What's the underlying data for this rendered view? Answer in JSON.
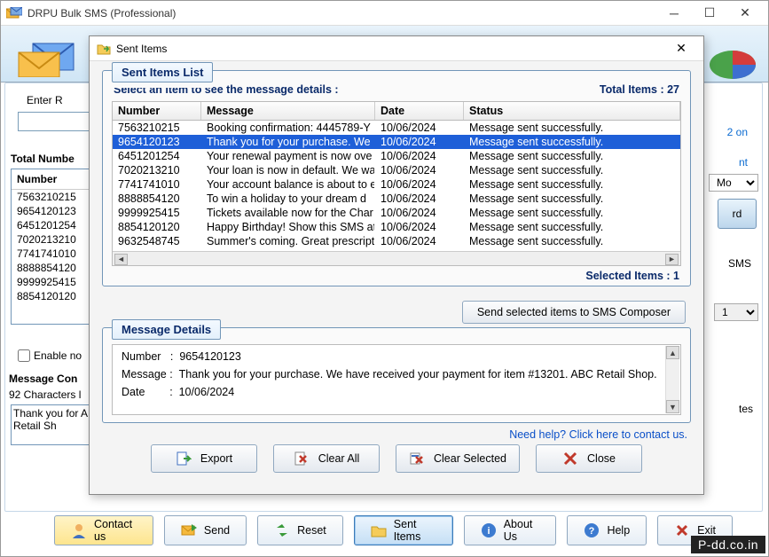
{
  "app": {
    "title": "DRPU Bulk SMS (Professional)"
  },
  "main": {
    "enterr_label": "Enter R",
    "right_text_2": "2 on",
    "right_text_nt": "nt",
    "mo_value": "Mo",
    "rd_label": "rd",
    "one_value": "1",
    "sms_label": "SMS",
    "tes_label": "tes",
    "totalnum_label": "Total Numbe",
    "num_header": "Number",
    "numbers": [
      "7563210215",
      "9654120123",
      "6451201254",
      "7020213210",
      "7741741010",
      "8888854120",
      "9999925415",
      "8854120120"
    ],
    "enable_label": "Enable no",
    "msgcon_label": "Message Con",
    "charlen_label": "92 Characters l",
    "msgcon_preview": "Thank you for\nABC Retail Sh"
  },
  "bottombar": {
    "contact": "Contact us",
    "send": "Send",
    "reset": "Reset",
    "sent": "Sent Items",
    "about": "About Us",
    "help": "Help",
    "exit": "Exit"
  },
  "modal": {
    "title": "Sent Items",
    "list_section": "Sent Items List",
    "select_text": "Select an item to see the message details :",
    "total_items_label": "Total Items : 27",
    "columns": {
      "number": "Number",
      "message": "Message",
      "date": "Date",
      "status": "Status"
    },
    "rows": [
      {
        "number": "7563210215",
        "message": "Booking confirmation: 4445789-Y",
        "date": "10/06/2024",
        "status": "Message sent successfully.",
        "selected": false
      },
      {
        "number": "9654120123",
        "message": "Thank you for your purchase. We",
        "date": "10/06/2024",
        "status": "Message sent successfully.",
        "selected": true
      },
      {
        "number": "6451201254",
        "message": "Your renewal payment is now ove",
        "date": "10/06/2024",
        "status": "Message sent successfully.",
        "selected": false
      },
      {
        "number": "7020213210",
        "message": "Your loan is now in default. We wa",
        "date": "10/06/2024",
        "status": "Message sent successfully.",
        "selected": false
      },
      {
        "number": "7741741010",
        "message": "Your account balance is about to e",
        "date": "10/06/2024",
        "status": "Message sent successfully.",
        "selected": false
      },
      {
        "number": "8888854120",
        "message": " To win a holiday to your dream d",
        "date": "10/06/2024",
        "status": "Message sent successfully.",
        "selected": false
      },
      {
        "number": "9999925415",
        "message": "Tickets available now for the Char",
        "date": "10/06/2024",
        "status": "Message sent successfully.",
        "selected": false
      },
      {
        "number": "8854120120",
        "message": "Happy Birthday! Show this SMS at",
        "date": "10/06/2024",
        "status": "Message sent successfully.",
        "selected": false
      },
      {
        "number": "9632548745",
        "message": "Summer's coming. Great prescripti",
        "date": "10/06/2024",
        "status": "Message sent successfully.",
        "selected": false
      }
    ],
    "selected_items_label": "Selected Items : 1",
    "composer_btn": "Send selected items to SMS Composer",
    "details_section": "Message Details",
    "details": {
      "number_label": "Number",
      "number_value": "9654120123",
      "message_label": "Message",
      "message_value": "Thank you for your purchase. We have received your payment for item #13201. ABC Retail Shop.",
      "date_label": "Date",
      "date_value": "10/06/2024"
    },
    "help_link": "Need help? Click here to contact us.",
    "actions": {
      "export": "Export",
      "clear_all": "Clear All",
      "clear_selected": "Clear Selected",
      "close": "Close"
    }
  },
  "watermark": "P-dd.co.in"
}
